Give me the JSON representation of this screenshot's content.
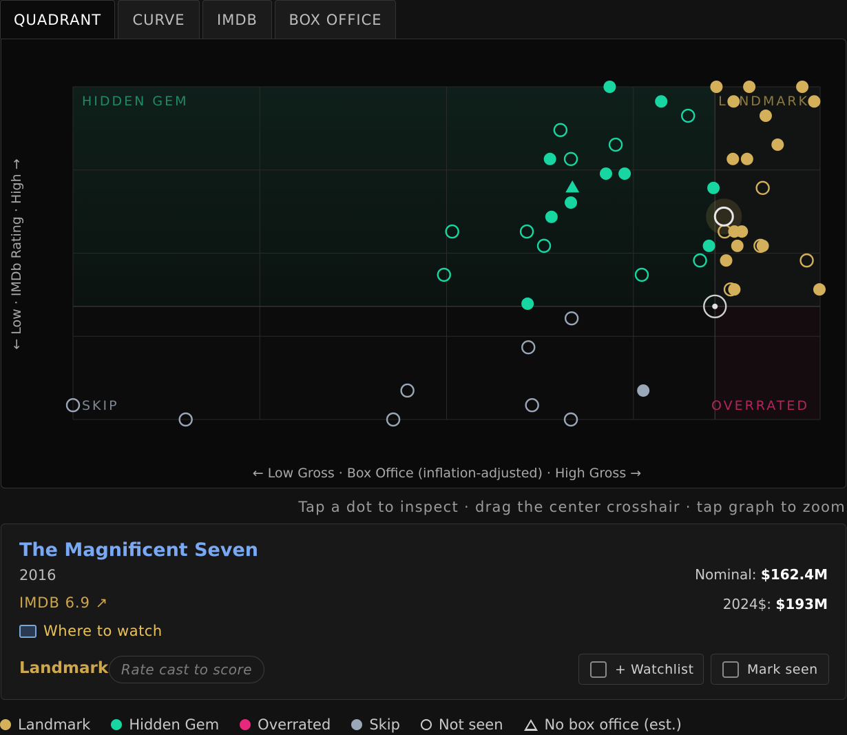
{
  "tabs": [
    {
      "label": "QUADRANT",
      "active": true
    },
    {
      "label": "CURVE",
      "active": false
    },
    {
      "label": "IMDB",
      "active": false
    },
    {
      "label": "BOX OFFICE",
      "active": false
    }
  ],
  "colors": {
    "landmark": "#d4b05a",
    "hidden_gem": "#17d6a2",
    "overrated": "#e8287c",
    "skip": "#9aa7b8",
    "not_seen": "#cfcfcf"
  },
  "quadrants": {
    "hidden_gem": "HIDDEN GEM",
    "landmark": "LANDMARK",
    "skip": "SKIP",
    "overrated": "OVERRATED"
  },
  "axes": {
    "y_label": "← Low · IMDb Rating · High →",
    "x_label": "← Low Gross · Box Office (inflation-adjusted) · High Gross →"
  },
  "chart_data": {
    "type": "scatter",
    "xlabel": "← Low Gross · Box Office (inflation-adjusted) · High Gross →",
    "ylabel": "← Low · IMDb Rating · High →",
    "xlim": [
      0,
      100
    ],
    "ylim": [
      0,
      100
    ],
    "grid": true,
    "crosshair": {
      "x": 86,
      "y": 34
    },
    "selected": {
      "x": 87.2,
      "y": 61
    },
    "points": [
      {
        "x": 71.9,
        "y": 100,
        "cat": "hidden_gem",
        "seen": true
      },
      {
        "x": 78.8,
        "y": 95.6,
        "cat": "hidden_gem",
        "seen": true
      },
      {
        "x": 82.4,
        "y": 91.3,
        "cat": "hidden_gem",
        "seen": false
      },
      {
        "x": 65.3,
        "y": 87.0,
        "cat": "hidden_gem",
        "seen": false
      },
      {
        "x": 72.7,
        "y": 82.6,
        "cat": "hidden_gem",
        "seen": false
      },
      {
        "x": 63.9,
        "y": 78.3,
        "cat": "hidden_gem",
        "seen": true
      },
      {
        "x": 66.7,
        "y": 78.3,
        "cat": "hidden_gem",
        "seen": false
      },
      {
        "x": 71.4,
        "y": 73.9,
        "cat": "hidden_gem",
        "seen": true
      },
      {
        "x": 73.9,
        "y": 73.9,
        "cat": "hidden_gem",
        "seen": true
      },
      {
        "x": 66.9,
        "y": 69.8,
        "cat": "hidden_gem",
        "seen": true,
        "no_box_office": true
      },
      {
        "x": 85.8,
        "y": 69.6,
        "cat": "hidden_gem",
        "seen": true
      },
      {
        "x": 66.7,
        "y": 65.2,
        "cat": "hidden_gem",
        "seen": true
      },
      {
        "x": 64.1,
        "y": 60.9,
        "cat": "hidden_gem",
        "seen": true
      },
      {
        "x": 50.8,
        "y": 56.5,
        "cat": "hidden_gem",
        "seen": false
      },
      {
        "x": 60.8,
        "y": 56.5,
        "cat": "hidden_gem",
        "seen": false
      },
      {
        "x": 63.1,
        "y": 52.2,
        "cat": "hidden_gem",
        "seen": false
      },
      {
        "x": 85.2,
        "y": 52.2,
        "cat": "hidden_gem",
        "seen": true
      },
      {
        "x": 84.0,
        "y": 47.8,
        "cat": "hidden_gem",
        "seen": false
      },
      {
        "x": 49.7,
        "y": 43.5,
        "cat": "hidden_gem",
        "seen": false
      },
      {
        "x": 76.2,
        "y": 43.5,
        "cat": "hidden_gem",
        "seen": false
      },
      {
        "x": 60.9,
        "y": 34.8,
        "cat": "hidden_gem",
        "seen": true
      },
      {
        "x": 86.2,
        "y": 100,
        "cat": "landmark",
        "seen": true
      },
      {
        "x": 90.6,
        "y": 100,
        "cat": "landmark",
        "seen": true
      },
      {
        "x": 97.7,
        "y": 100,
        "cat": "landmark",
        "seen": true
      },
      {
        "x": 88.5,
        "y": 95.6,
        "cat": "landmark",
        "seen": true
      },
      {
        "x": 99.3,
        "y": 95.6,
        "cat": "landmark",
        "seen": true
      },
      {
        "x": 92.8,
        "y": 91.3,
        "cat": "landmark",
        "seen": true
      },
      {
        "x": 94.4,
        "y": 82.6,
        "cat": "landmark",
        "seen": true
      },
      {
        "x": 88.4,
        "y": 78.3,
        "cat": "landmark",
        "seen": true
      },
      {
        "x": 90.3,
        "y": 78.3,
        "cat": "landmark",
        "seen": true
      },
      {
        "x": 92.4,
        "y": 69.6,
        "cat": "landmark",
        "seen": false
      },
      {
        "x": 87.3,
        "y": 56.5,
        "cat": "landmark",
        "seen": false
      },
      {
        "x": 88.6,
        "y": 56.5,
        "cat": "landmark",
        "seen": true
      },
      {
        "x": 89.6,
        "y": 56.5,
        "cat": "landmark",
        "seen": true
      },
      {
        "x": 89.0,
        "y": 52.2,
        "cat": "landmark",
        "seen": true
      },
      {
        "x": 92.1,
        "y": 52.2,
        "cat": "landmark",
        "seen": false
      },
      {
        "x": 92.4,
        "y": 52.2,
        "cat": "landmark",
        "seen": true
      },
      {
        "x": 87.5,
        "y": 47.8,
        "cat": "landmark",
        "seen": true
      },
      {
        "x": 98.3,
        "y": 47.8,
        "cat": "landmark",
        "seen": false
      },
      {
        "x": 88.1,
        "y": 39.1,
        "cat": "landmark",
        "seen": false
      },
      {
        "x": 88.6,
        "y": 39.1,
        "cat": "landmark",
        "seen": true
      },
      {
        "x": 100,
        "y": 39.1,
        "cat": "landmark",
        "seen": true
      },
      {
        "x": 66.8,
        "y": 30.4,
        "cat": "skip",
        "seen": false
      },
      {
        "x": 61.0,
        "y": 21.7,
        "cat": "skip",
        "seen": false
      },
      {
        "x": 44.8,
        "y": 8.7,
        "cat": "skip",
        "seen": false
      },
      {
        "x": 76.4,
        "y": 8.7,
        "cat": "skip",
        "seen": true
      },
      {
        "x": 0,
        "y": 4.3,
        "cat": "skip",
        "seen": false
      },
      {
        "x": 61.5,
        "y": 4.3,
        "cat": "skip",
        "seen": false
      },
      {
        "x": 15.1,
        "y": 0,
        "cat": "skip",
        "seen": false
      },
      {
        "x": 42.9,
        "y": 0,
        "cat": "skip",
        "seen": false
      },
      {
        "x": 66.7,
        "y": 0,
        "cat": "skip",
        "seen": false
      }
    ]
  },
  "hint": "Tap a dot to inspect · drag the center crosshair · tap graph to zoom",
  "movie": {
    "title": "The Magnificent Seven",
    "year": "2016",
    "imdb": "IMDB 6.9 ↗",
    "where_to_watch": "Where to watch",
    "verdict": "Landmark",
    "rate_placeholder": "Rate cast to score",
    "nominal_label": "Nominal:",
    "nominal_value": "$162.4M",
    "real_label": "2024$:",
    "real_value": "$193M",
    "watchlist_label": "+ Watchlist",
    "mark_seen_label": "Mark seen"
  },
  "legend": [
    {
      "label": "Landmark",
      "kind": "dot",
      "color": "#d4b05a"
    },
    {
      "label": "Hidden Gem",
      "kind": "dot",
      "color": "#17d6a2"
    },
    {
      "label": "Overrated",
      "kind": "dot",
      "color": "#e8287c"
    },
    {
      "label": "Skip",
      "kind": "dot",
      "color": "#9aa7b8"
    },
    {
      "label": "Not seen",
      "kind": "ring",
      "color": "#cfcfcf"
    },
    {
      "label": "No box office (est.)",
      "kind": "triangle",
      "color": "#cfcfcf"
    }
  ]
}
